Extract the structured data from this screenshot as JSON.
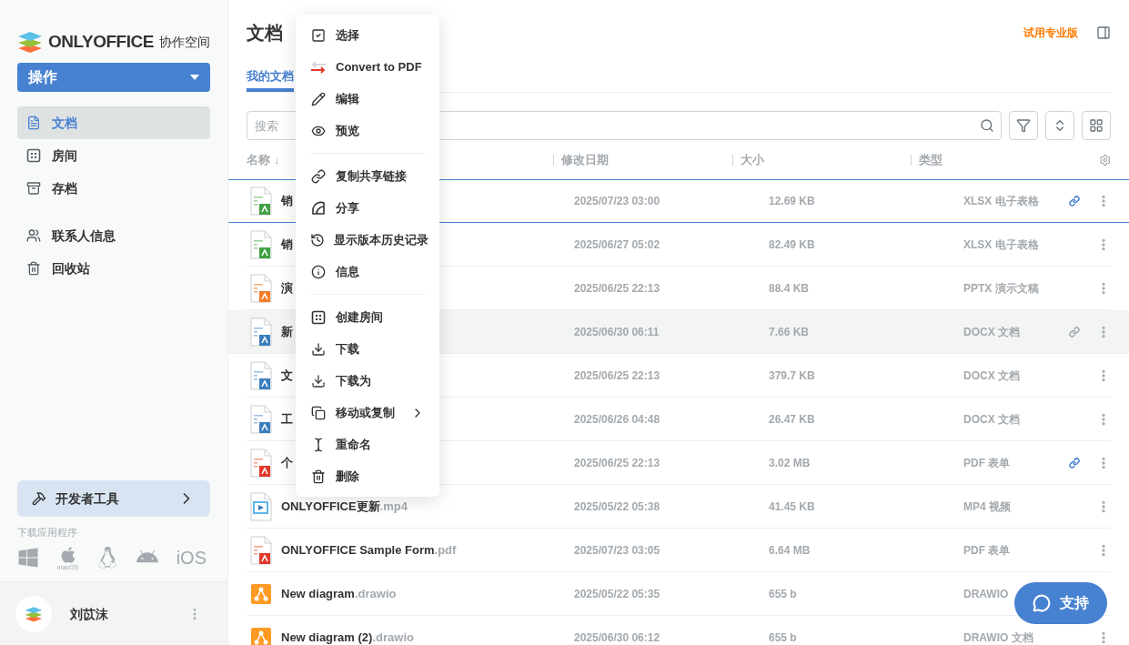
{
  "sidebar": {
    "brand": "ONLYOFFICE",
    "brand_suffix": "协作空间",
    "actions_button": "操作",
    "nav": [
      {
        "kind": "doc",
        "label": "文档",
        "selected": true
      },
      {
        "kind": "rooms",
        "label": "房间",
        "selected": false
      },
      {
        "kind": "archive",
        "label": "存档",
        "selected": false
      }
    ],
    "nav2": [
      {
        "kind": "contacts",
        "label": "联系人信息",
        "selected": false
      },
      {
        "kind": "trash",
        "label": "回收站",
        "selected": false
      }
    ],
    "dev_tools": "开发者工具",
    "download_title": "下载应用程序",
    "apps": [
      {
        "kind": "windows"
      },
      {
        "kind": "macos",
        "label": "macOS"
      },
      {
        "kind": "linux"
      },
      {
        "kind": "android"
      },
      {
        "kind": "ios",
        "label": "iOS"
      }
    ],
    "user": {
      "name": "刘苡沫"
    }
  },
  "header": {
    "title": "文档",
    "trial_link": "试用专业版"
  },
  "tabs": [
    {
      "label": "我的文档",
      "selected": true
    }
  ],
  "search": {
    "placeholder": "搜索"
  },
  "table": {
    "columns": [
      "名称",
      "修改日期",
      "大小",
      "类型"
    ],
    "sort_mark": "↓",
    "rows": [
      {
        "kind": "xlsx",
        "name": "销",
        "date": "2025/07/23 03:00",
        "size": "12.69 KB",
        "type": "XLSX 电子表格",
        "selected": true,
        "highlighted": false,
        "shared": true,
        "actions": true
      },
      {
        "kind": "xlsx",
        "name": "销",
        "date": "2025/06/27 05:02",
        "size": "82.49 KB",
        "type": "XLSX 电子表格",
        "selected": false,
        "highlighted": false,
        "shared": false,
        "actions": true
      },
      {
        "kind": "pptx",
        "name": "演",
        "date": "2025/06/25 22:13",
        "size": "88.4 KB",
        "type": "PPTX 演示文稿",
        "selected": false,
        "highlighted": false,
        "shared": false,
        "actions": true
      },
      {
        "kind": "docx",
        "name": "新",
        "date": "2025/06/30 06:11",
        "size": "7.66 KB",
        "type": "DOCX 文档",
        "selected": false,
        "highlighted": true,
        "shared": false,
        "actions": true
      },
      {
        "kind": "docx",
        "name": "文",
        "date": "2025/06/25 22:13",
        "size": "379.7 KB",
        "type": "DOCX 文档",
        "selected": false,
        "highlighted": false,
        "shared": false,
        "actions": true
      },
      {
        "kind": "docx",
        "name": "工",
        "date": "2025/06/26 04:48",
        "size": "26.47 KB",
        "type": "DOCX 文档",
        "selected": false,
        "highlighted": false,
        "shared": false,
        "actions": true
      },
      {
        "kind": "pdf",
        "name": "个",
        "date": "2025/06/25 22:13",
        "size": "3.02 MB",
        "type": "PDF 表单",
        "selected": false,
        "highlighted": false,
        "shared": true,
        "actions": true
      },
      {
        "kind": "mp4",
        "name": "ONLYOFFICE更新",
        "ext": ".mp4",
        "date": "2025/05/22 05:38",
        "size": "41.45 KB",
        "type": "MP4 视频",
        "selected": false,
        "highlighted": false,
        "shared": false,
        "actions": true
      },
      {
        "kind": "pdf",
        "name": "ONLYOFFICE Sample Form",
        "ext": ".pdf",
        "date": "2025/07/23 03:05",
        "size": "6.64 MB",
        "type": "PDF 表单",
        "selected": false,
        "highlighted": false,
        "shared": false,
        "actions": true
      },
      {
        "kind": "drawio",
        "name": "New diagram",
        "ext": ".drawio",
        "date": "2025/05/22 05:35",
        "size": "655 b",
        "type": "DRAWIO",
        "selected": false,
        "highlighted": false,
        "actions": false
      },
      {
        "kind": "drawio",
        "name": "New diagram (2)",
        "ext": ".drawio",
        "date": "2025/06/30 06:12",
        "size": "655 b",
        "type": "DRAWIO 文档",
        "selected": false,
        "highlighted": false,
        "shared": false,
        "actions": true
      }
    ]
  },
  "context_menu": [
    {
      "kind": "select",
      "label": "选择"
    },
    {
      "kind": "convert",
      "label": "Convert to PDF"
    },
    {
      "kind": "edit",
      "label": "编辑"
    },
    {
      "kind": "preview",
      "label": "预览"
    },
    {
      "kind": "separator"
    },
    {
      "kind": "link",
      "label": "复制共享链接"
    },
    {
      "kind": "share",
      "label": "分享"
    },
    {
      "kind": "history",
      "label": "显示版本历史记录"
    },
    {
      "kind": "info",
      "label": "信息"
    },
    {
      "kind": "separator"
    },
    {
      "kind": "room",
      "label": "创建房间"
    },
    {
      "kind": "download",
      "label": "下载"
    },
    {
      "kind": "download_as",
      "label": "下载为"
    },
    {
      "kind": "move",
      "label": "移动或复制",
      "submenu": true
    },
    {
      "kind": "rename",
      "label": "重命名"
    },
    {
      "kind": "delete",
      "label": "删除"
    }
  ],
  "support_button": "支持"
}
